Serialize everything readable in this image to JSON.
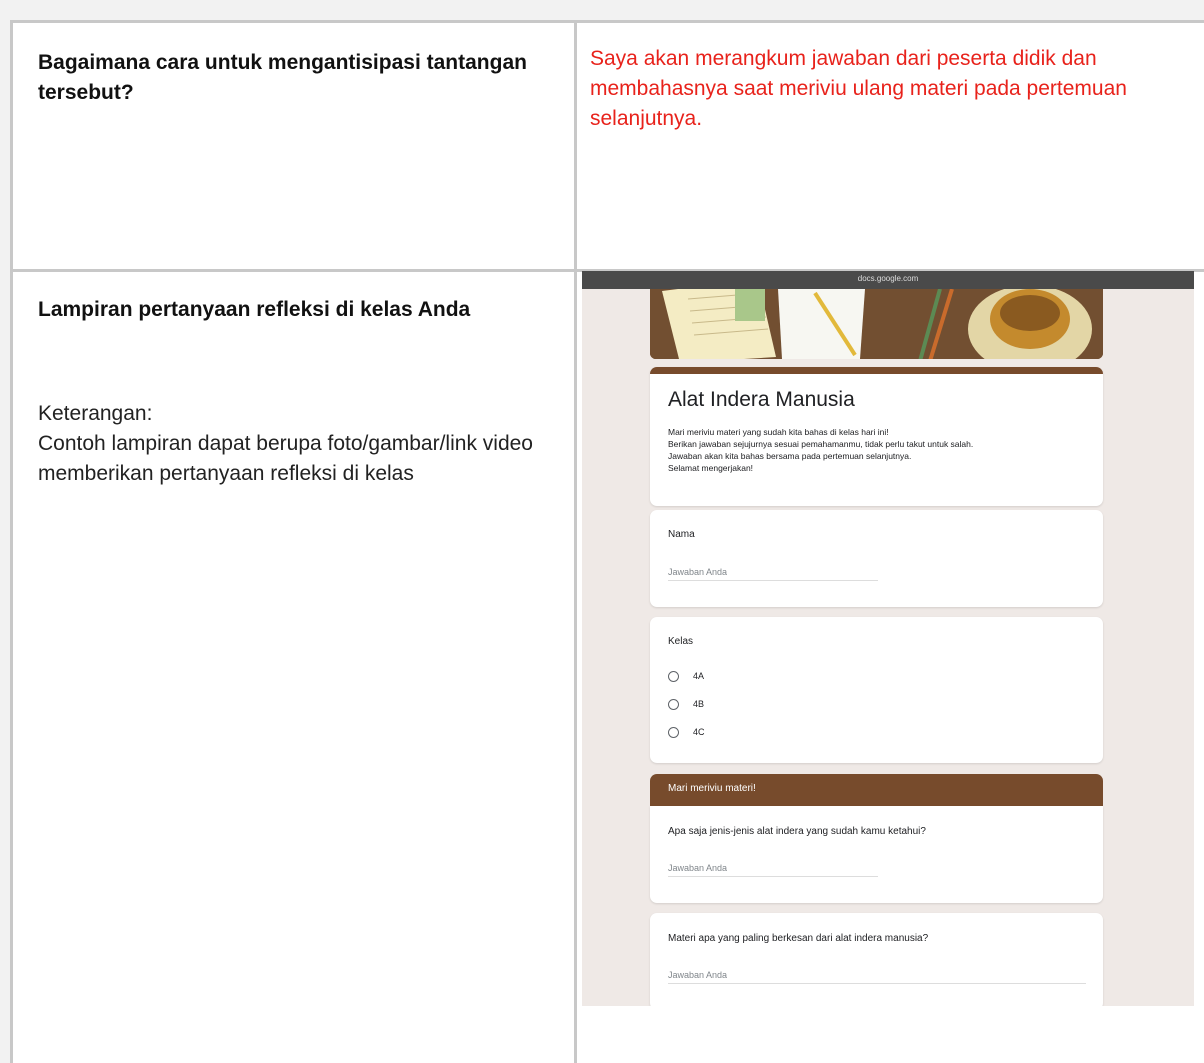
{
  "row1": {
    "question": "Bagaimana cara untuk mengantisipasi tantangan tersebut?",
    "answer": "Saya akan merangkum jawaban dari peserta didik dan membahasnya saat meriviu ulang materi pada pertemuan selanjutnya."
  },
  "row2": {
    "title": "Lampiran pertanyaan refleksi di kelas Anda",
    "note_label": "Keterangan:",
    "note_text": "Contoh lampiran dapat berupa foto/gambar/link video memberikan pertanyaan refleksi di kelas"
  },
  "form": {
    "url": "docs.google.com",
    "title": "Alat Indera Manusia",
    "description": [
      "Mari meriviu materi yang sudah kita bahas di kelas hari ini!",
      "Berikan jawaban sejujurnya sesuai pemahamanmu, tidak perlu takut untuk salah.",
      "Jawaban akan kita bahas bersama pada pertemuan selanjutnya.",
      "Selamat mengerjakan!"
    ],
    "name_label": "Nama",
    "answer_placeholder": "Jawaban Anda",
    "class_label": "Kelas",
    "class_options": [
      "4A",
      "4B",
      "4C"
    ],
    "section_title": "Mari meriviu materi!",
    "q1": "Apa saja jenis-jenis alat indera yang sudah kamu ketahui?",
    "q2": "Materi apa yang paling berkesan dari alat indera manusia?",
    "colors": {
      "header": "#774b2c",
      "answer_text": "#e8221b"
    }
  }
}
